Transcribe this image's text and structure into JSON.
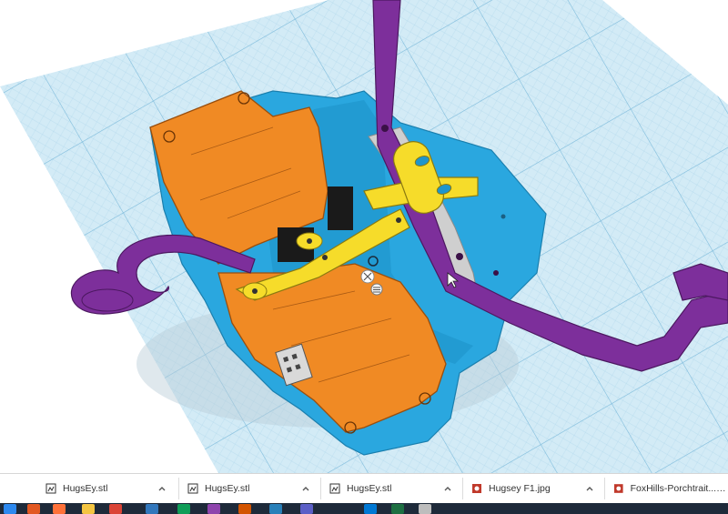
{
  "workspace": {
    "workplane_color": "#cfe7f3",
    "grid_color": "#8cc3e0",
    "part_colors": {
      "orange": "#f08a24",
      "blue": "#2aa7df",
      "purple": "#7d2f9b",
      "yellow": "#f6dc2a",
      "gray": "#c9c9c9"
    },
    "model_icons": [
      "pivot-handle-icon",
      "menu-lines-icon",
      "cursor-arrow-icon"
    ]
  },
  "downloads": {
    "items": [
      {
        "name": "HugsEy.stl",
        "icon": "stl-file-icon"
      },
      {
        "name": "HugsEy.stl",
        "icon": "stl-file-icon"
      },
      {
        "name": "HugsEy.stl",
        "icon": "stl-file-icon"
      },
      {
        "name": "Hugsey F1.jpg",
        "icon": "jpg-file-icon"
      },
      {
        "name": "FoxHills-Porchtrait....jpg",
        "icon": "jpg-file-icon"
      }
    ]
  },
  "taskbar": {
    "icons": [
      "start-icon",
      "browser-icon",
      "firefox-icon",
      "folder-icon",
      "chrome-icon",
      "edge-icon",
      "file-explorer-icon",
      "photos-icon",
      "paint-icon",
      "calendar-icon",
      "teams-icon",
      "outlook-icon",
      "excel-icon",
      "app-icon"
    ]
  }
}
